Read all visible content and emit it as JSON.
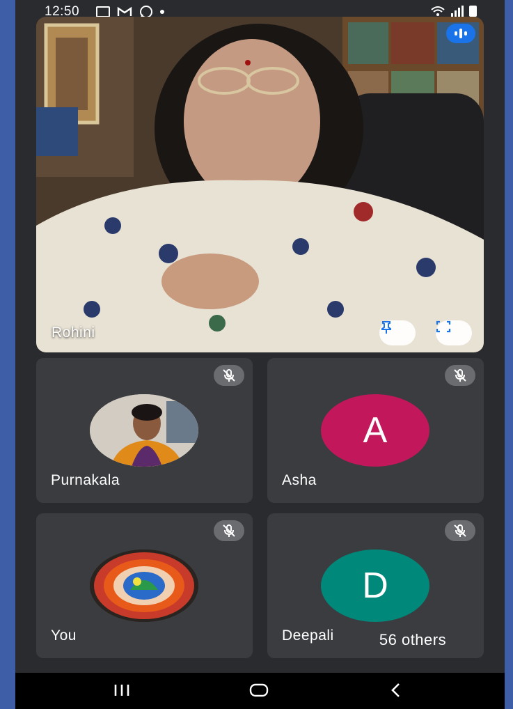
{
  "status_bar": {
    "time": "12:50",
    "notification_icons": [
      "image-icon",
      "gmail-icon",
      "whatsapp-icon",
      "dot-icon"
    ],
    "right_icons": [
      "wifi-calling-icon",
      "signal-icon",
      "battery-icon"
    ]
  },
  "main_participant": {
    "name": "Rohini",
    "speaking_indicator": "audio-level-icon",
    "pin_icon": "pin-icon",
    "fullscreen_icon": "fullscreen-icon"
  },
  "participants": [
    {
      "name": "Purnakala",
      "avatar_type": "photo",
      "muted": true
    },
    {
      "name": "Asha",
      "avatar_type": "initial",
      "initial": "A",
      "color": "#c2185b",
      "muted": true
    },
    {
      "name": "You",
      "avatar_type": "photo",
      "muted": true
    },
    {
      "name": "Deepali",
      "avatar_type": "initial",
      "initial": "D",
      "color": "#00897b",
      "muted": true
    }
  ],
  "others_label": "56 others",
  "nav_bar": [
    "recents-icon",
    "home-icon",
    "back-icon"
  ],
  "colors": {
    "background": "#2a2b2f",
    "tile": "#3b3c40",
    "accent": "#1a73e8"
  }
}
